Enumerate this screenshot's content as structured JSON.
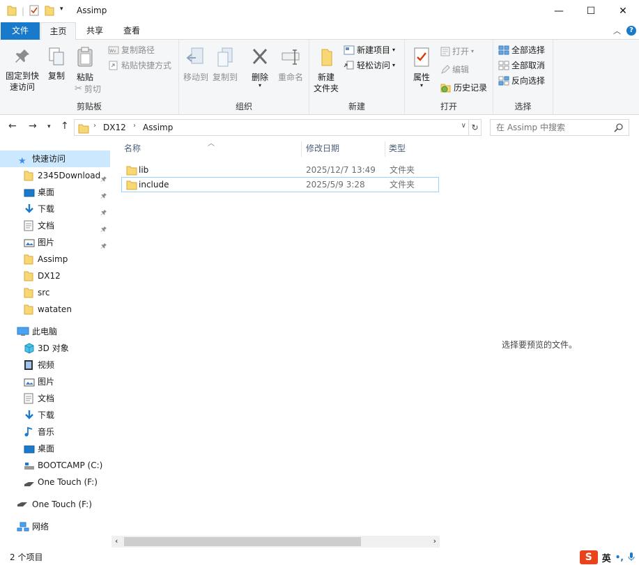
{
  "window": {
    "title": "Assimp",
    "minimize_glyph": "—",
    "maximize_glyph": "☐",
    "close_glyph": "✕"
  },
  "tabs": {
    "file": "文件",
    "home": "主页",
    "share": "共享",
    "view": "查看",
    "help_glyph": "?",
    "collapse_glyph": "︿"
  },
  "ribbon": {
    "clipboard": {
      "label": "剪贴板",
      "pin": "固定到快\n速访问",
      "pin_line1": "固定到快",
      "pin_line2": "速访问",
      "copy": "复制",
      "paste": "粘贴",
      "copy_path": "复制路径",
      "paste_shortcut": "粘贴快捷方式",
      "cut": "剪切"
    },
    "organize": {
      "label": "组织",
      "move_to": "移动到",
      "copy_to": "复制到",
      "delete": "删除",
      "rename": "重命名"
    },
    "new": {
      "label": "新建",
      "new_folder_line1": "新建",
      "new_folder_line2": "文件夹",
      "new_item": "新建项目",
      "easy_access": "轻松访问"
    },
    "open": {
      "label": "打开",
      "properties": "属性",
      "open": "打开",
      "edit": "编辑",
      "history": "历史记录"
    },
    "select": {
      "label": "选择",
      "select_all": "全部选择",
      "select_none": "全部取消",
      "invert": "反向选择"
    }
  },
  "address": {
    "crumbs": [
      "DX12",
      "Assimp"
    ],
    "search_placeholder": "在 Assimp 中搜索"
  },
  "nav": {
    "quick_access": "快速访问",
    "quick_items": [
      {
        "label": "2345Download",
        "icon": "folder-icon",
        "pinned": true
      },
      {
        "label": "桌面",
        "icon": "desktop-icon",
        "pinned": true
      },
      {
        "label": "下载",
        "icon": "download-icon",
        "pinned": true
      },
      {
        "label": "文档",
        "icon": "document-icon",
        "pinned": true
      },
      {
        "label": "图片",
        "icon": "picture-icon",
        "pinned": true
      },
      {
        "label": "Assimp",
        "icon": "folder-icon",
        "pinned": false
      },
      {
        "label": "DX12",
        "icon": "folder-icon",
        "pinned": false
      },
      {
        "label": "src",
        "icon": "folder-icon",
        "pinned": false
      },
      {
        "label": "wataten",
        "icon": "folder-icon",
        "pinned": false
      }
    ],
    "this_pc": "此电脑",
    "pc_items": [
      {
        "label": "3D 对象",
        "icon": "3d-objects-icon"
      },
      {
        "label": "视频",
        "icon": "video-icon"
      },
      {
        "label": "图片",
        "icon": "picture-icon"
      },
      {
        "label": "文档",
        "icon": "document-icon"
      },
      {
        "label": "下载",
        "icon": "download-icon"
      },
      {
        "label": "音乐",
        "icon": "music-icon"
      },
      {
        "label": "桌面",
        "icon": "desktop-icon"
      },
      {
        "label": "BOOTCAMP (C:)",
        "icon": "drive-icon"
      },
      {
        "label": "One Touch (F:)",
        "icon": "usb-drive-icon"
      }
    ],
    "one_touch": "One Touch (F:)",
    "network": "网络"
  },
  "filelist": {
    "columns": {
      "name": "名称",
      "modified": "修改日期",
      "type": "类型"
    },
    "rows": [
      {
        "name": "lib",
        "modified": "2025/12/7 13:49",
        "type": "文件夹"
      },
      {
        "name": "include",
        "modified": "2025/5/9 3:28",
        "type": "文件夹"
      }
    ]
  },
  "preview": {
    "text": "选择要预览的文件。"
  },
  "status": {
    "count": "2 个项目"
  },
  "ime": {
    "lang": "英",
    "punct": "•,"
  },
  "colors": {
    "accent": "#1979ca",
    "folder": "#f8d775",
    "selection": "#cce8ff",
    "focus_border": "#99d1ff"
  }
}
